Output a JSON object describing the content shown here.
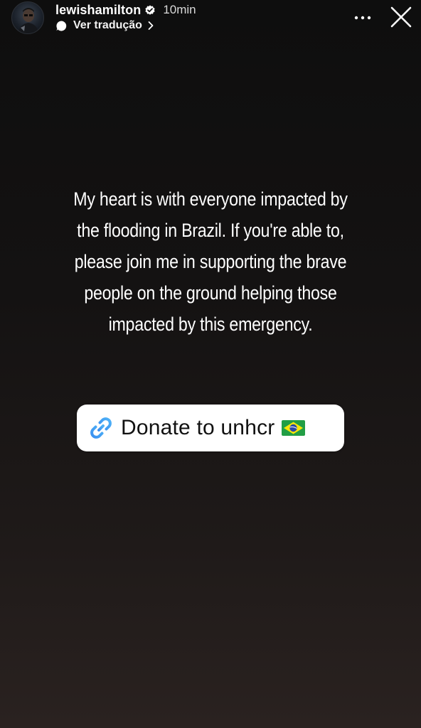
{
  "header": {
    "username": "lewishamilton",
    "time": "10min",
    "translate_label": "Ver tradução",
    "icons": {
      "verified": "verified-badge-icon",
      "translate": "chat-bubble-icon",
      "chevron": "chevron-right-icon",
      "more": "more-horizontal-icon",
      "close": "close-icon"
    }
  },
  "caption": {
    "lines": [
      "My heart is with everyone impacted by",
      "the flooding in Brazil. If you're able to,",
      "please join me in supporting the brave",
      "people on the ground helping those",
      "impacted by this emergency."
    ]
  },
  "link_sticker": {
    "label": "Donate to unhcr",
    "icon": "link-icon",
    "emoji": "brazil-flag-icon",
    "link_color": "#3897f0"
  },
  "colors": {
    "background_top": "#0e0e0e",
    "background_bottom": "#2a2220",
    "text": "#ffffff",
    "sticker_background": "#ffffff"
  }
}
